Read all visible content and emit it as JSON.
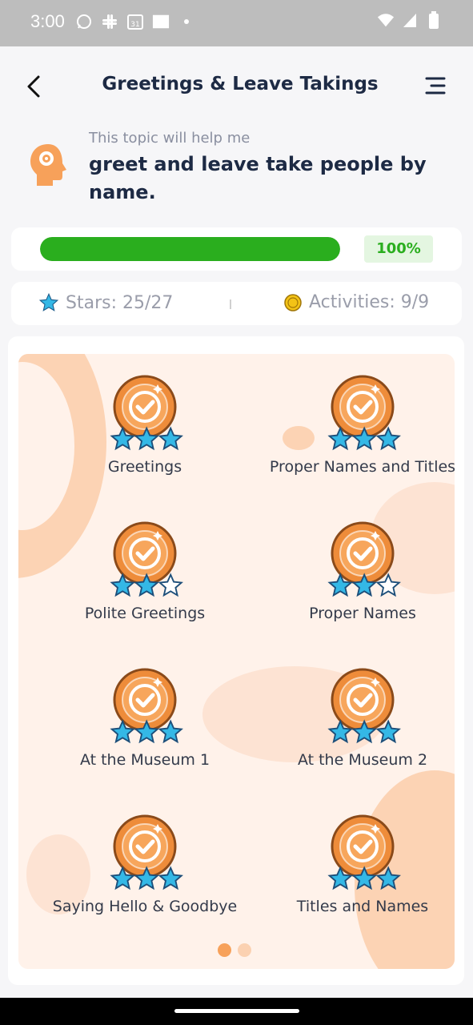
{
  "status_bar": {
    "time": "3:00"
  },
  "header": {
    "title": "Greetings & Leave Takings"
  },
  "intro": {
    "subtitle": "This topic will help me",
    "goal": "greet and leave take people by name."
  },
  "progress": {
    "value_percent": 100,
    "label": "100%",
    "color": "#2aae1e"
  },
  "stats": {
    "stars": "Stars: 25/27",
    "activities": "Activities: 9/9"
  },
  "activities": [
    {
      "label": "Greetings",
      "stars": 3,
      "max_stars": 3
    },
    {
      "label": "Proper Names and Titles",
      "stars": 3,
      "max_stars": 3
    },
    {
      "label": "Polite Greetings",
      "stars": 2,
      "max_stars": 3
    },
    {
      "label": "Proper Names",
      "stars": 2,
      "max_stars": 3
    },
    {
      "label": "At the Museum 1",
      "stars": 3,
      "max_stars": 3
    },
    {
      "label": "At the Museum 2",
      "stars": 3,
      "max_stars": 3
    },
    {
      "label": "Saying Hello & Goodbye",
      "stars": 3,
      "max_stars": 3
    },
    {
      "label": "Titles and Names",
      "stars": 3,
      "max_stars": 3
    }
  ],
  "pager": {
    "pages": 2,
    "current": 1
  },
  "colors": {
    "accent": "#f28b3b",
    "star": "#34b8e6",
    "title": "#1d2a44"
  }
}
